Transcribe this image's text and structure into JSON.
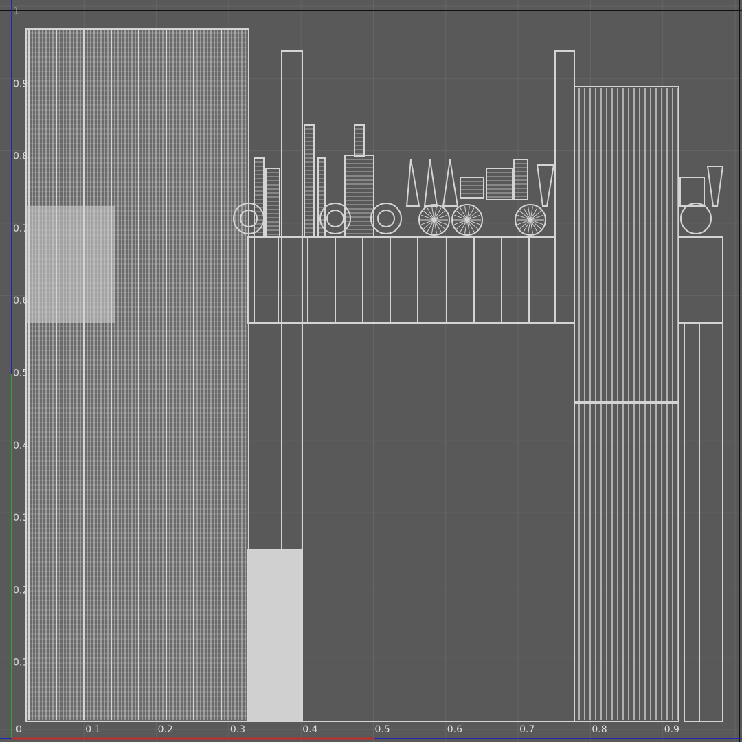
{
  "uv_editor": {
    "x_ticks": [
      "0",
      "0.1",
      "0.2",
      "0.3",
      "0.4",
      "0.5",
      "0.6",
      "0.7",
      "0.8",
      "0.9"
    ],
    "y_ticks": [
      "1",
      "0.9",
      "0.8",
      "0.7",
      "0.6",
      "0.5",
      "0.4",
      "0.3",
      "0.2",
      "0.1"
    ],
    "grid": true,
    "colors": {
      "background": "#595959",
      "grid_line": "#656565",
      "uv_wire": "#d4d4d4",
      "border_frame": "#111111",
      "u_axis": "#c0302a",
      "v_axis_green": "#2fa52f",
      "v_axis_blue": "#2424b8"
    }
  }
}
